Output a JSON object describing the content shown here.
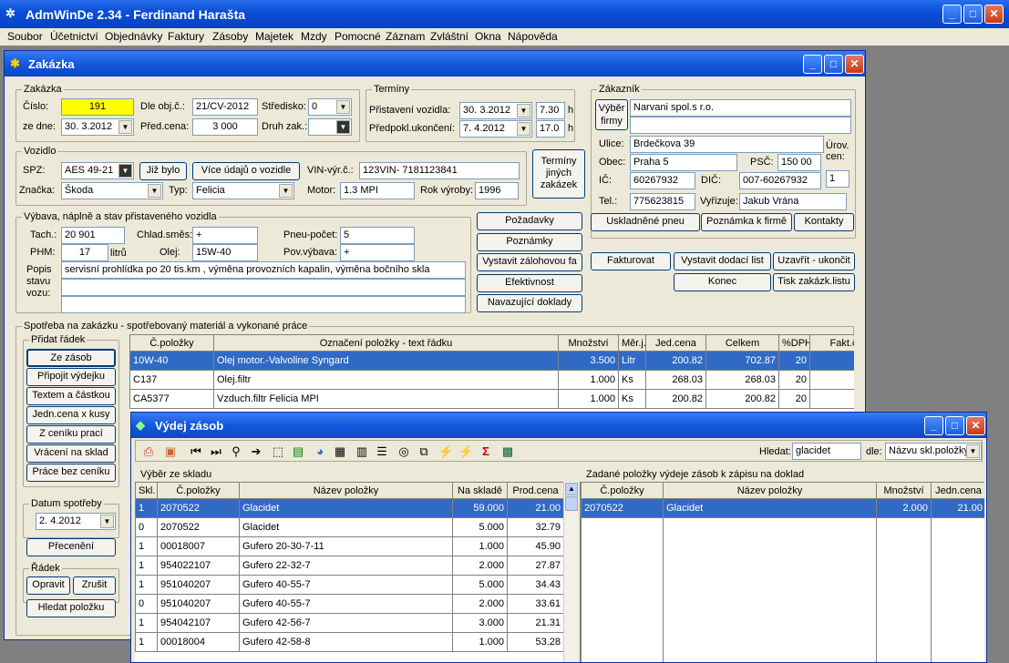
{
  "app": {
    "title": "AdmWinDe 2.34 - Ferdinand Harašta",
    "menu": [
      "Soubor",
      "Účetnictví",
      "Objednávky",
      "Faktury",
      "Zásoby",
      "Majetek",
      "Mzdy",
      "Pomocné",
      "Záznam",
      "Zvláštní",
      "Okna",
      "Nápověda"
    ]
  },
  "zakazka": {
    "title": "Zakázka",
    "grp_zakazka": "Zakázka",
    "cislo_label": "Číslo:",
    "cislo": "191",
    "ze_dne_label": "ze dne:",
    "ze_dne": "30. 3.2012",
    "dle_obj_label": "Dle obj.č.:",
    "dle_obj": "21/CV-2012",
    "pred_cena_label": "Před.cena:",
    "pred_cena": "3 000",
    "stredisko_label": "Středisko:",
    "stredisko": "0",
    "druh_label": "Druh zak.:",
    "druh": "",
    "grp_terminy": "Termíny",
    "pristaveni_label": "Přistavení vozidla:",
    "pristaveni": "30. 3.2012",
    "pristaveni_cas": "7.30",
    "h1": "h",
    "ukonceni_label": "Předpokl.ukončení:",
    "ukonceni": "7. 4.2012",
    "ukonceni_cas": "17.0",
    "h2": "h",
    "grp_zakaznik": "Zákazník",
    "vyber_firmy": "Výběr firmy",
    "firma": "Narvani spol.s r.o.",
    "firma2": "",
    "ulice_label": "Ulice:",
    "ulice": "Brdečkova 39",
    "obec_label": "Obec:",
    "obec": "Praha 5",
    "psc_label": "PSČ:",
    "psc": "150 00",
    "urov_label": "Úrov. cen:",
    "urov": "1",
    "ic_label": "IČ:",
    "ic": "60267932",
    "dic_label": "DIČ:",
    "dic": "007-60267932",
    "tel_label": "Tel.:",
    "tel": "775623815",
    "vyrizuje_label": "Vyřizuje:",
    "vyrizuje": "Jakub Vrána",
    "btn_pneu": "Uskladněné pneu",
    "btn_poznamka_firme": "Poznámka k firmě",
    "btn_kontakty": "Kontakty",
    "grp_vozidlo": "Vozidlo",
    "spz_label": "SPZ:",
    "spz": "AES 49-21",
    "btn_jiz_bylo": "Již bylo",
    "btn_vice_udaju": "Více údajů o vozidle",
    "vin_label": "VIN-výr.č.:",
    "vin": "123VIN- 7181123841",
    "znacka_label": "Značka:",
    "znacka": "Škoda",
    "typ_label": "Typ:",
    "typ": "Felicia",
    "motor_label": "Motor:",
    "motor": "1.3 MPI",
    "rok_label": "Rok výroby:",
    "rok": "1996",
    "btn_terminy_jinych": "Termíny jiných zakázek",
    "grp_vybava": "Výbava, náplně a stav přistaveného vozidla",
    "tach_label": "Tach.:",
    "tach": "20 901",
    "phm_label": "PHM:",
    "phm": "17",
    "litru": "litrů",
    "chlad_label": "Chlad.směs:",
    "chlad": "+",
    "olej_label": "Olej:",
    "olej": "15W-40",
    "pneu_label": "Pneu-počet:",
    "pneu": "5",
    "pov_label": "Pov.výbava:",
    "pov": "+",
    "popis_label": "Popis stavu vozu:",
    "popis1": "servisní prohlídka po 20 tis.km , výměna provozních kapalin, výměna bočního skla",
    "popis2": "",
    "popis3": "",
    "btn_pozadavky": "Požadavky",
    "btn_poznamky": "Poznámky",
    "btn_zaloha": "Vystavit zálohovou fa",
    "btn_efektivnost": "Efektivnost",
    "btn_navazujici": "Navazující doklady",
    "btn_fakturovat": "Fakturovat",
    "btn_dodaci": "Vystavit dodací list",
    "btn_uzavrit": "Uzavřít - ukončit",
    "btn_konec": "Konec",
    "btn_tisk": "Tisk zakázk.listu",
    "grp_spotreba": "Spotřeba na zakázku - spotřebovaný materiál a vykonané práce",
    "grp_pridat": "Přidat řádek",
    "btn_ze_zasob": "Ze zásob",
    "btn_pripojit": "Připojit výdejku",
    "btn_textem": "Textem a částkou",
    "btn_jedn": "Jedn.cena x kusy",
    "btn_ceniku": "Z ceníku prací",
    "btn_vraceni": "Vrácení na sklad",
    "btn_prace": "Práce bez ceníku",
    "grp_datum": "Datum spotřeby",
    "datum": "2. 4.2012",
    "btn_preceneni": "Přecenění",
    "grp_radek": "Řádek",
    "btn_opravit": "Opravit",
    "btn_zrusit": "Zrušit",
    "btn_hledat": "Hledat položku",
    "cols": [
      "Č.položky",
      "Označení položky - text řádku",
      "Množství",
      "Měr.j.",
      "Jed.cena",
      "Celkem",
      "%DPH",
      "Fakt.č"
    ],
    "rows": [
      [
        "10W-40",
        "Olej motor.-Valvoline Syngard",
        "3.500",
        "Litr",
        "200.82",
        "702.87",
        "20",
        ""
      ],
      [
        "C137",
        "Olej.filtr",
        "1.000",
        "Ks",
        "268.03",
        "268.03",
        "20",
        ""
      ],
      [
        "CA5377",
        "Vzduch.filtr Felicia MPI",
        "1.000",
        "Ks",
        "200.82",
        "200.82",
        "20",
        ""
      ]
    ]
  },
  "vydej": {
    "title": "Výdej zásob",
    "hledat_label": "Hledat:",
    "hledat": "glacidet",
    "dle_label": "dle:",
    "dle": "Názvu skl.položky",
    "vyber_label": "Výběr ze skladu",
    "zadane_label": "Zadané položky výdeje zásob k zápisu na doklad",
    "left_cols": [
      "Skl.",
      "Č.položky",
      "Název položky",
      "Na skladě",
      "Prod.cena"
    ],
    "left_rows": [
      [
        "1",
        "2070522",
        "Glacidet",
        "59.000",
        "21.00"
      ],
      [
        "0",
        "2070522",
        "Glacidet",
        "5.000",
        "32.79"
      ],
      [
        "1",
        "00018007",
        "Gufero 20-30-7-11",
        "1.000",
        "45.90"
      ],
      [
        "1",
        "954022107",
        "Gufero 22-32-7",
        "2.000",
        "27.87"
      ],
      [
        "1",
        "951040207",
        "Gufero 40-55-7",
        "5.000",
        "34.43"
      ],
      [
        "0",
        "951040207",
        "Gufero 40-55-7",
        "2.000",
        "33.61"
      ],
      [
        "1",
        "954042107",
        "Gufero 42-56-7",
        "3.000",
        "21.31"
      ],
      [
        "1",
        "00018004",
        "Gufero 42-58-8",
        "1.000",
        "53.28"
      ]
    ],
    "right_cols": [
      "Č.položky",
      "Název položky",
      "Množství",
      "Jedn.cena"
    ],
    "right_rows": [
      [
        "2070522",
        "Glacidet",
        "2.000",
        "21.00"
      ]
    ]
  }
}
